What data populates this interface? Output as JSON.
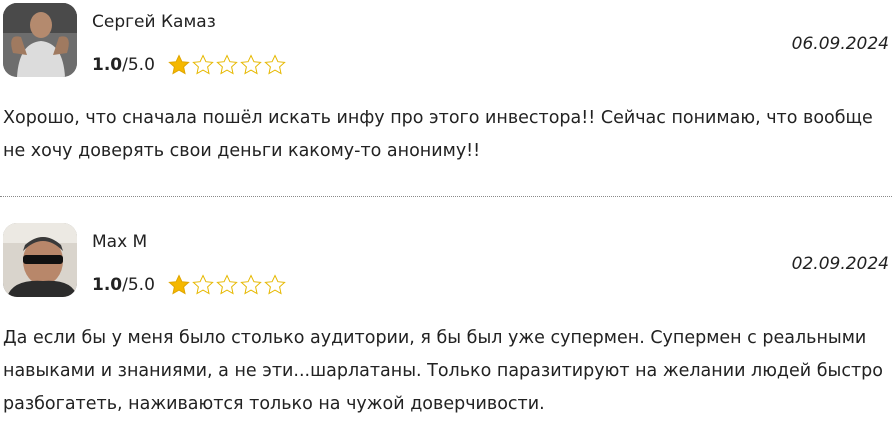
{
  "reviews": [
    {
      "author": "Сергей Камаз",
      "rating_value": "1.0",
      "rating_max": "/5.0",
      "stars_filled": 1,
      "stars_total": 5,
      "date": "06.09.2024",
      "text": "Хорошо, что сначала пошёл искать инфу про этого инвестора!! Сейчас понимаю, что вообще не хочу доверять свои деньги какому-то анониму!!"
    },
    {
      "author": "Max M",
      "rating_value": "1.0",
      "rating_max": "/5.0",
      "stars_filled": 1,
      "stars_total": 5,
      "date": "02.09.2024",
      "text": "Да если бы у меня было столько аудитории, я бы был уже супермен. Супермен с реальными навыками и знаниями, а не эти...шарлатаны. Только паразитируют на желании людей быстро разбогатеть, наживаются только на чужой доверчивости."
    }
  ],
  "colors": {
    "star_filled": "#f5b800",
    "star_empty_stroke": "#e6b800",
    "divider": "#8a8a8a"
  }
}
